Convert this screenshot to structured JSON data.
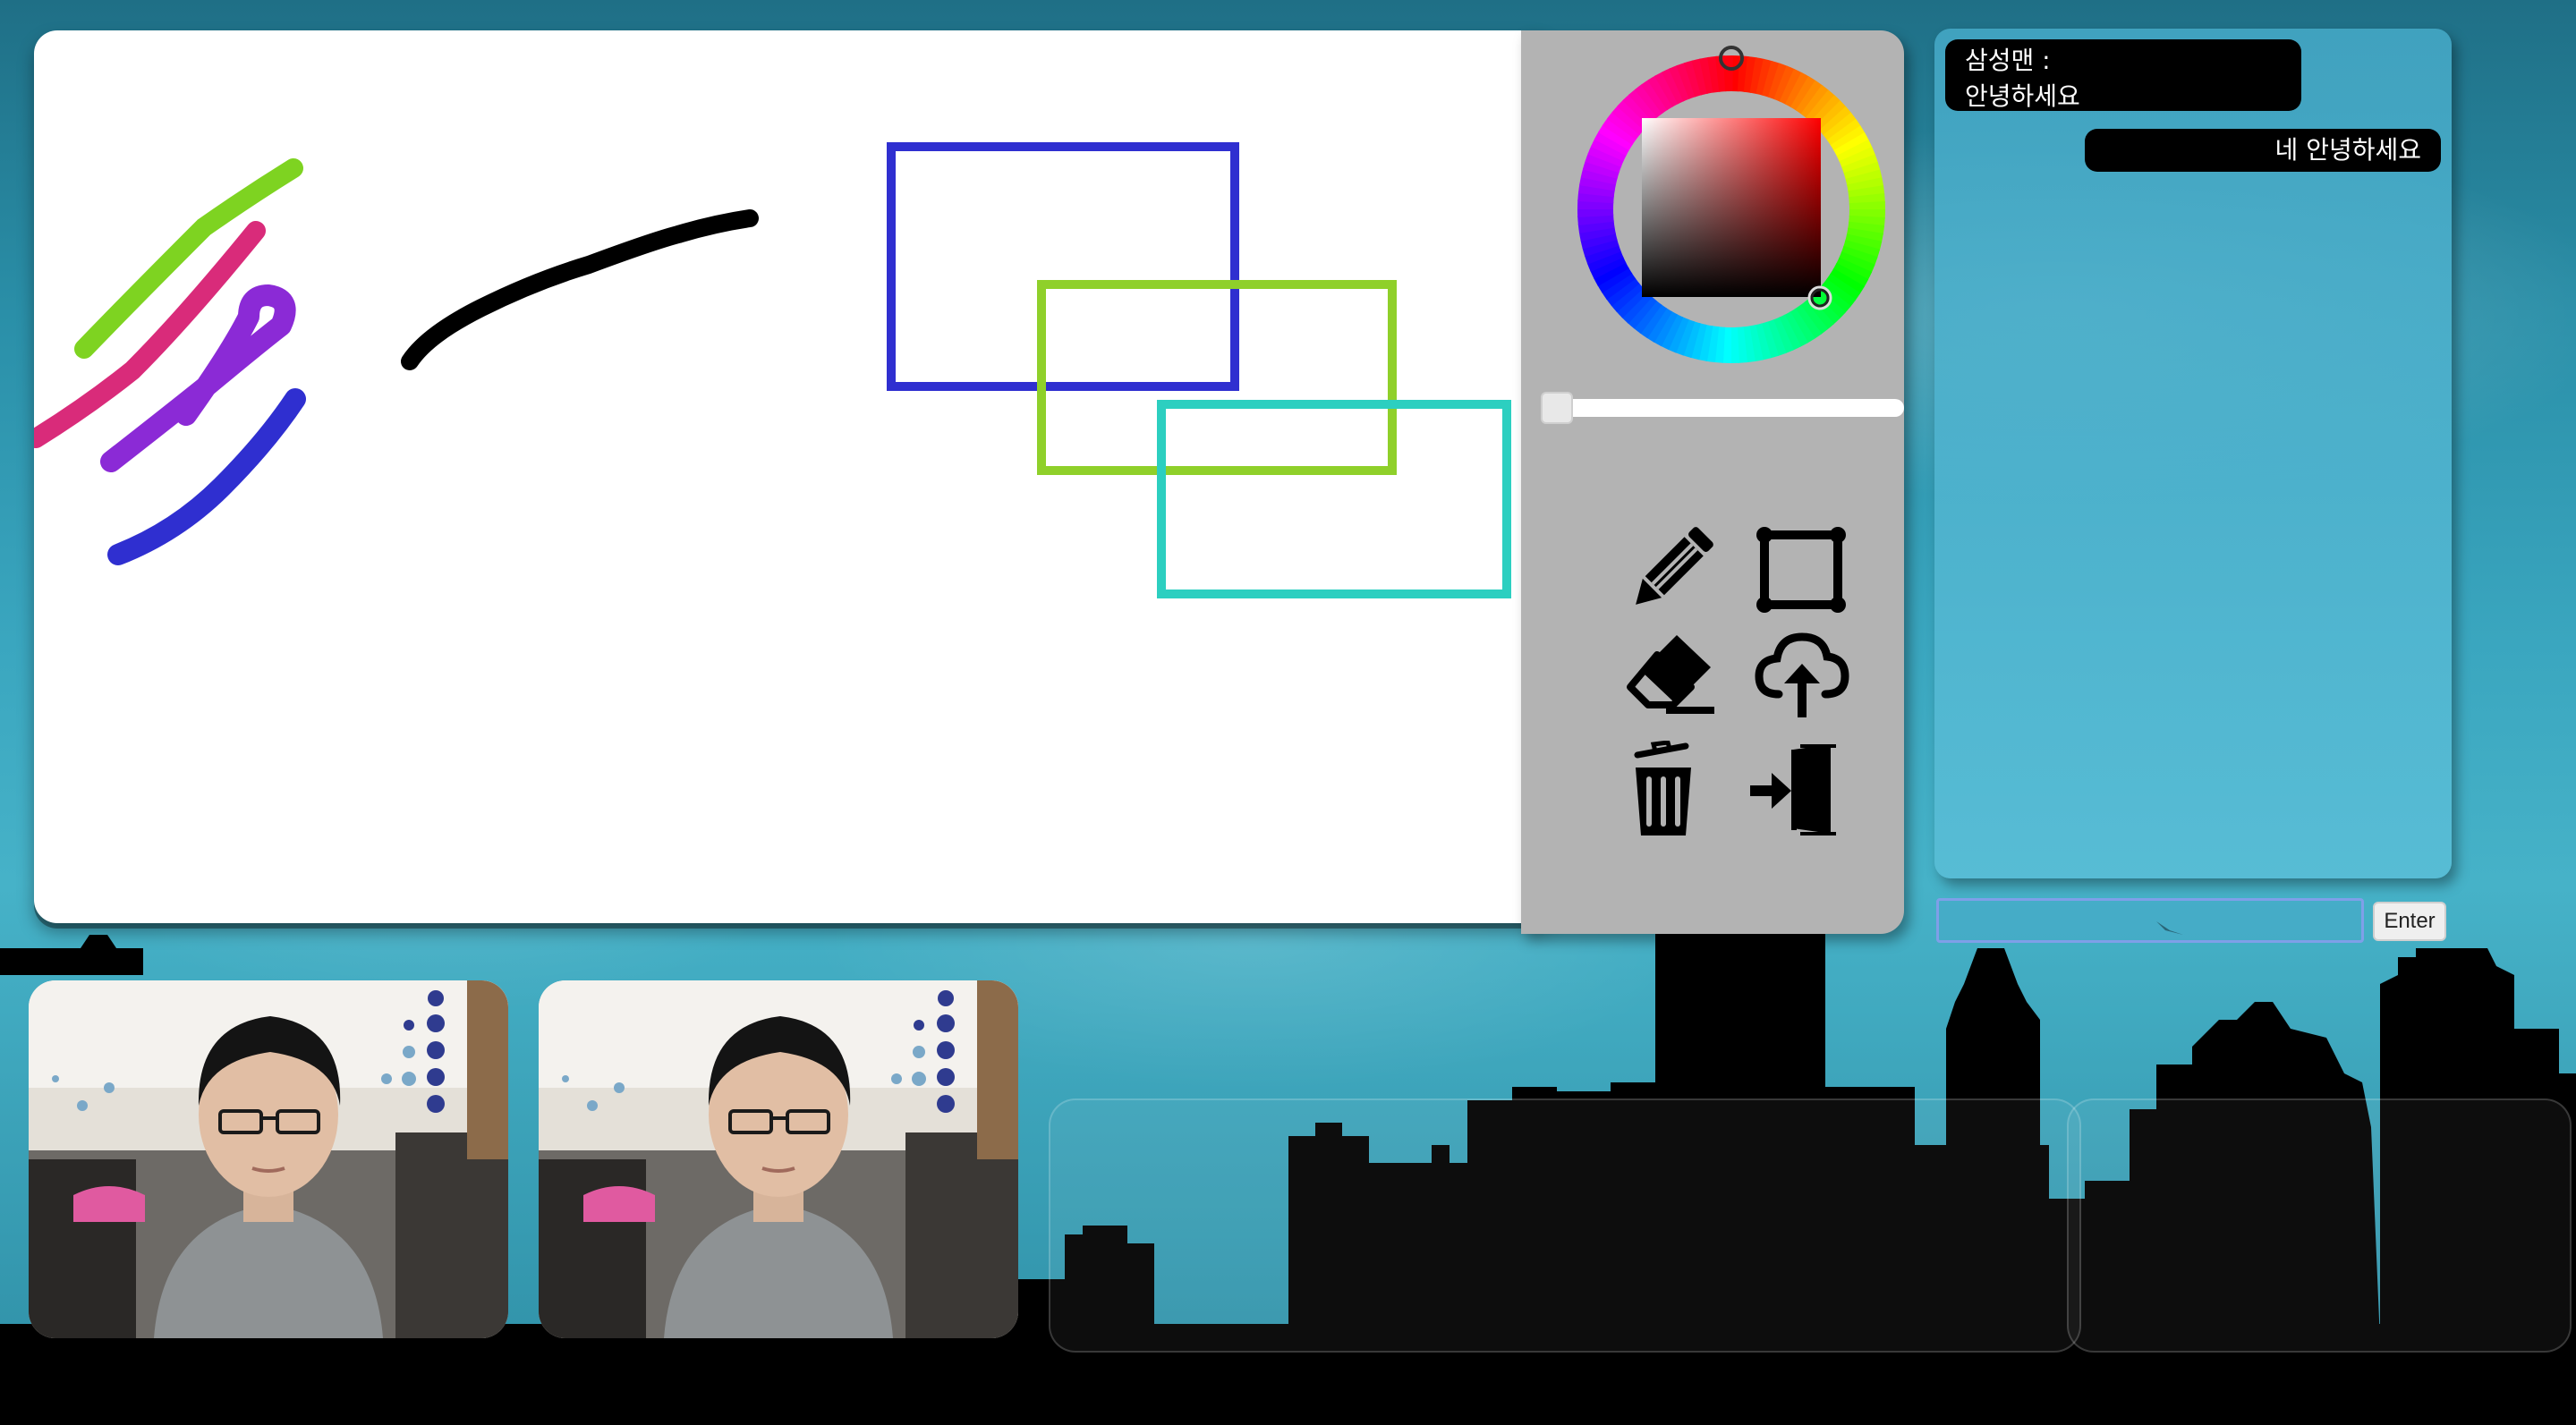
{
  "board": {
    "strokes": [
      {
        "name": "green-stroke",
        "color": "#7ed321"
      },
      {
        "name": "pink-stroke",
        "color": "#d92b7a"
      },
      {
        "name": "purple-stroke",
        "color": "#8b2ad6"
      },
      {
        "name": "blue-stroke",
        "color": "#2f2fd0"
      },
      {
        "name": "black-stroke",
        "color": "#000000"
      }
    ],
    "rectangles": [
      {
        "name": "blue-rectangle",
        "color": "#2f2fd0"
      },
      {
        "name": "green-rectangle",
        "color": "#8fd02a"
      },
      {
        "name": "teal-rectangle",
        "color": "#2ccfc0"
      }
    ]
  },
  "color_picker": {
    "selected_hue": "#ff0000",
    "brush_size_value": 0
  },
  "tools": [
    {
      "name": "pencil-tool",
      "icon": "pencil-icon"
    },
    {
      "name": "rectangle-tool",
      "icon": "rectangle-icon"
    },
    {
      "name": "eraser-tool",
      "icon": "eraser-icon"
    },
    {
      "name": "upload-tool",
      "icon": "cloud-upload-icon"
    },
    {
      "name": "clear-tool",
      "icon": "trash-icon"
    },
    {
      "name": "exit-tool",
      "icon": "exit-door-icon"
    }
  ],
  "chat": {
    "messages": [
      {
        "sender": "삼성맨 :",
        "text": "안녕하세요",
        "side": "left"
      },
      {
        "text": "네 안녕하세요",
        "side": "right"
      }
    ],
    "input_value": "",
    "enter_label": "Enter"
  },
  "videos": [
    {
      "name": "local-video"
    },
    {
      "name": "remote-video"
    }
  ],
  "colors": {
    "panel_gray": "#b3b3b3",
    "chat_bubble": "#000000"
  }
}
